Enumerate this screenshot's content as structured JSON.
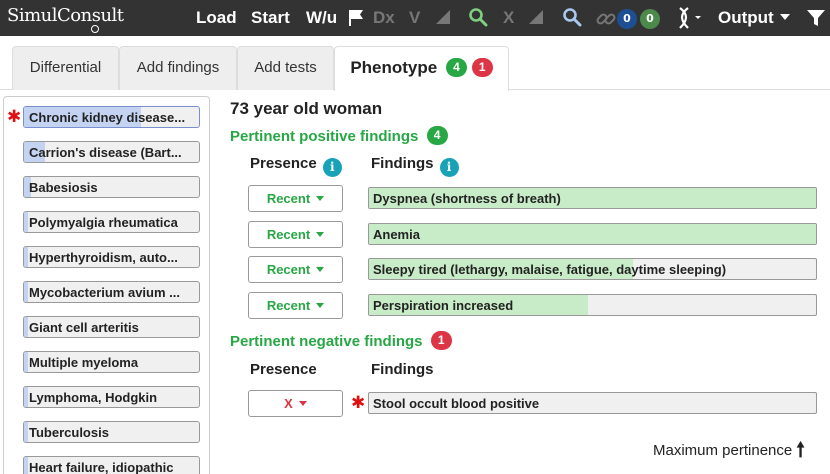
{
  "app": {
    "logo": "SimulConsult"
  },
  "toolbar": {
    "load": "Load",
    "start": "Start",
    "wu": "W/u",
    "dx": "Dx",
    "v": "V",
    "x": "X",
    "count_blue": "0",
    "count_green": "0",
    "output": "Output"
  },
  "tabs": [
    {
      "label": "Differential"
    },
    {
      "label": "Add findings"
    },
    {
      "label": "Add tests"
    },
    {
      "label": "Phenotype",
      "badge_positive": "4",
      "badge_negative": "1"
    }
  ],
  "diagnoses": [
    {
      "label": "Chronic kidney disease...",
      "fill": 0.67,
      "flagged": true
    },
    {
      "label": "Carrion's disease (Bart...",
      "fill": 0.12
    },
    {
      "label": "Babesiosis",
      "fill": 0.04
    },
    {
      "label": "Polymyalgia rheumatica",
      "fill": 0.02
    },
    {
      "label": "Hyperthyroidism, auto...",
      "fill": 0.02
    },
    {
      "label": "Mycobacterium avium ...",
      "fill": 0.02
    },
    {
      "label": "Giant cell arteritis",
      "fill": 0.02
    },
    {
      "label": "Multiple myeloma",
      "fill": 0.02
    },
    {
      "label": "Lymphoma, Hodgkin",
      "fill": 0.02
    },
    {
      "label": "Tuberculosis",
      "fill": 0.02
    },
    {
      "label": "Heart failure, idiopathic",
      "fill": 0.02
    }
  ],
  "patient": {
    "title": "73 year old woman"
  },
  "positive": {
    "heading": "Pertinent positive findings",
    "count": "4",
    "presence_header": "Presence",
    "findings_header": "Findings",
    "rows": [
      {
        "presence": "Recent",
        "finding": "Dyspnea (shortness of breath)",
        "fill": 1.0
      },
      {
        "presence": "Recent",
        "finding": "Anemia",
        "fill": 1.0
      },
      {
        "presence": "Recent",
        "finding": "Sleepy tired (lethargy, malaise, fatigue, daytime sleeping)",
        "fill": 0.59
      },
      {
        "presence": "Recent",
        "finding": "Perspiration increased",
        "fill": 0.49
      }
    ]
  },
  "negative": {
    "heading": "Pertinent negative findings",
    "count": "1",
    "presence_header": "Presence",
    "findings_header": "Findings",
    "rows": [
      {
        "presence": "X",
        "finding": "Stool occult blood positive",
        "fill": 0.0,
        "flagged": true
      }
    ]
  },
  "footer": {
    "sort_label": "Maximum pertinence"
  },
  "colors": {
    "topbar": "#333333",
    "positive": "#28a745",
    "negative": "#dc3545",
    "info": "#17a2b8",
    "dx_fill": "#c4d3f2",
    "finding_fill": "#c8ecc8"
  },
  "icons": [
    "flag-icon",
    "search-icon",
    "chain-link-icon",
    "dna-icon",
    "funnel-icon",
    "info-icon",
    "sort-arrow-up-icon",
    "asterisk-icon",
    "caret-down-icon"
  ]
}
